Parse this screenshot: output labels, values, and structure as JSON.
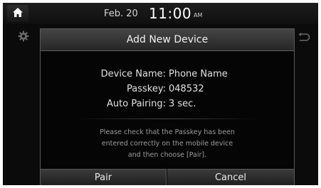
{
  "status_bar": {
    "home_icon": "home-icon",
    "date": "Feb. 20",
    "time": "11:00",
    "ampm": "AM"
  },
  "background": {
    "settings_icon": "gear-icon",
    "back_icon": "back-arrow-icon"
  },
  "popup": {
    "title": "Add New Device",
    "rows": [
      {
        "label": "Device Name:",
        "value": "Phone Name"
      },
      {
        "label": "Passkey:",
        "value": "048532"
      },
      {
        "label": "Auto Pairing:",
        "value": "3 sec."
      }
    ],
    "message_lines": [
      "Please check that the Passkey has been",
      "entered correctly on the mobile device",
      "and then choose [Pair]."
    ],
    "buttons": {
      "pair": "Pair",
      "cancel": "Cancel"
    }
  },
  "colors": {
    "screen_bg": "#0b0b0b",
    "header_bg": "#3a3a3a",
    "text": "#e2e2e2",
    "message_text": "#9d9d9d"
  }
}
